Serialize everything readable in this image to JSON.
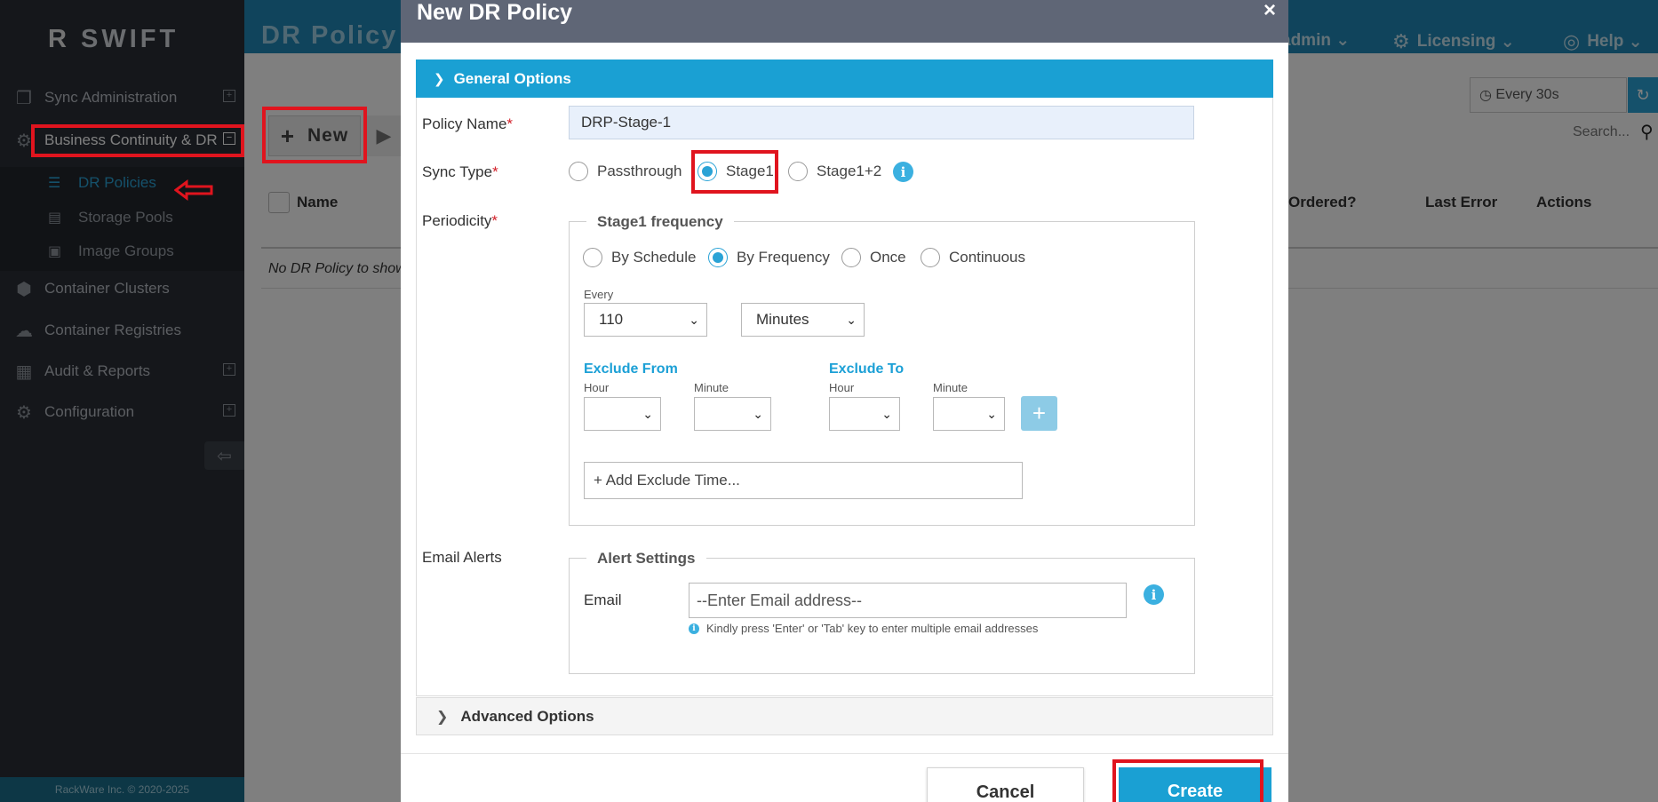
{
  "app": {
    "logo": "R SWIFT",
    "logo_mark": "R",
    "logo_text": "SWIFT",
    "footer": "RackWare Inc. © 2020-2025"
  },
  "sidebar": {
    "items": [
      {
        "label": "Sync Administration",
        "icon": "sync-admin-icon",
        "expand": "+"
      },
      {
        "label": "Business Continuity & DR",
        "icon": "business-continuity-icon",
        "expand": "−"
      },
      {
        "label": "Container Clusters",
        "icon": "cube-icon"
      },
      {
        "label": "Container Registries",
        "icon": "cloud-icon"
      },
      {
        "label": "Audit & Reports",
        "icon": "table-icon",
        "expand": "+"
      },
      {
        "label": "Configuration",
        "icon": "gears-icon",
        "expand": "+"
      }
    ],
    "sub_items": [
      {
        "label": "DR Policies",
        "icon": "list-icon"
      },
      {
        "label": "Storage Pools",
        "icon": "database-icon"
      },
      {
        "label": "Image Groups",
        "icon": "image-group-icon"
      }
    ]
  },
  "header": {
    "page_title": "DR Policy",
    "user": "admin",
    "licensing": "Licensing",
    "help": "Help"
  },
  "toolbar": {
    "new_label": "New",
    "refresh_select": "Every 30s",
    "search_placeholder": "Search..."
  },
  "table": {
    "columns": [
      "Name",
      "Ordered?",
      "Last Error",
      "Actions"
    ],
    "empty_text": "No DR Policy to show"
  },
  "modal": {
    "title": "New DR Policy",
    "close": "×",
    "general_section": "General Options",
    "policy_name_label": "Policy Name",
    "policy_name_value": "DRP-Stage-1",
    "sync_type_label": "Sync Type",
    "sync_types": [
      "Passthrough",
      "Stage1",
      "Stage1+2"
    ],
    "sync_type_selected": "Stage1",
    "periodicity_label": "Periodicity",
    "frequency_legend": "Stage1 frequency",
    "frequency_modes": [
      "By Schedule",
      "By Frequency",
      "Once",
      "Continuous"
    ],
    "frequency_selected": "By Frequency",
    "every_label": "Every",
    "every_value": "110",
    "every_unit": "Minutes",
    "exclude_from_label": "Exclude From",
    "exclude_to_label": "Exclude To",
    "hour_label": "Hour",
    "minute_label": "Minute",
    "add_exclude_placeholder": "+ Add Exclude Time...",
    "email_alerts_label": "Email Alerts",
    "alert_legend": "Alert Settings",
    "email_label": "Email",
    "email_placeholder": "--Enter Email address--",
    "email_hint": "Kindly press 'Enter' or 'Tab' key to enter multiple email addresses",
    "advanced_section": "Advanced Options",
    "cancel_label": "Cancel",
    "create_label": "Create"
  },
  "colors": {
    "accent": "#1aa0d3",
    "sidebar_bg": "#2a2f37",
    "highlight_red": "#e0141e",
    "required": "#d21f28"
  }
}
